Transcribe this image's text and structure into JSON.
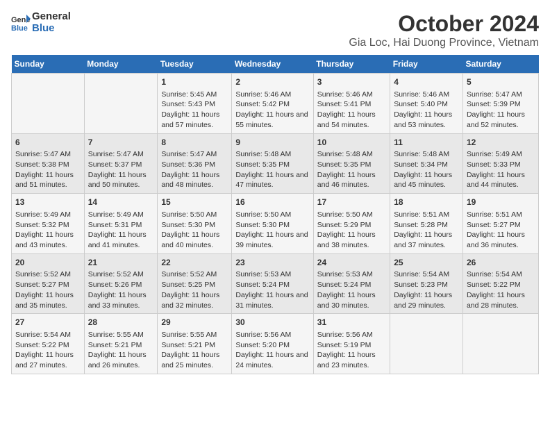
{
  "logo": {
    "line1": "General",
    "line2": "Blue"
  },
  "title": "October 2024",
  "subtitle": "Gia Loc, Hai Duong Province, Vietnam",
  "weekdays": [
    "Sunday",
    "Monday",
    "Tuesday",
    "Wednesday",
    "Thursday",
    "Friday",
    "Saturday"
  ],
  "weeks": [
    [
      {
        "day": "",
        "content": ""
      },
      {
        "day": "",
        "content": ""
      },
      {
        "day": "1",
        "content": "Sunrise: 5:45 AM\nSunset: 5:43 PM\nDaylight: 11 hours and 57 minutes."
      },
      {
        "day": "2",
        "content": "Sunrise: 5:46 AM\nSunset: 5:42 PM\nDaylight: 11 hours and 55 minutes."
      },
      {
        "day": "3",
        "content": "Sunrise: 5:46 AM\nSunset: 5:41 PM\nDaylight: 11 hours and 54 minutes."
      },
      {
        "day": "4",
        "content": "Sunrise: 5:46 AM\nSunset: 5:40 PM\nDaylight: 11 hours and 53 minutes."
      },
      {
        "day": "5",
        "content": "Sunrise: 5:47 AM\nSunset: 5:39 PM\nDaylight: 11 hours and 52 minutes."
      }
    ],
    [
      {
        "day": "6",
        "content": "Sunrise: 5:47 AM\nSunset: 5:38 PM\nDaylight: 11 hours and 51 minutes."
      },
      {
        "day": "7",
        "content": "Sunrise: 5:47 AM\nSunset: 5:37 PM\nDaylight: 11 hours and 50 minutes."
      },
      {
        "day": "8",
        "content": "Sunrise: 5:47 AM\nSunset: 5:36 PM\nDaylight: 11 hours and 48 minutes."
      },
      {
        "day": "9",
        "content": "Sunrise: 5:48 AM\nSunset: 5:35 PM\nDaylight: 11 hours and 47 minutes."
      },
      {
        "day": "10",
        "content": "Sunrise: 5:48 AM\nSunset: 5:35 PM\nDaylight: 11 hours and 46 minutes."
      },
      {
        "day": "11",
        "content": "Sunrise: 5:48 AM\nSunset: 5:34 PM\nDaylight: 11 hours and 45 minutes."
      },
      {
        "day": "12",
        "content": "Sunrise: 5:49 AM\nSunset: 5:33 PM\nDaylight: 11 hours and 44 minutes."
      }
    ],
    [
      {
        "day": "13",
        "content": "Sunrise: 5:49 AM\nSunset: 5:32 PM\nDaylight: 11 hours and 43 minutes."
      },
      {
        "day": "14",
        "content": "Sunrise: 5:49 AM\nSunset: 5:31 PM\nDaylight: 11 hours and 41 minutes."
      },
      {
        "day": "15",
        "content": "Sunrise: 5:50 AM\nSunset: 5:30 PM\nDaylight: 11 hours and 40 minutes."
      },
      {
        "day": "16",
        "content": "Sunrise: 5:50 AM\nSunset: 5:30 PM\nDaylight: 11 hours and 39 minutes."
      },
      {
        "day": "17",
        "content": "Sunrise: 5:50 AM\nSunset: 5:29 PM\nDaylight: 11 hours and 38 minutes."
      },
      {
        "day": "18",
        "content": "Sunrise: 5:51 AM\nSunset: 5:28 PM\nDaylight: 11 hours and 37 minutes."
      },
      {
        "day": "19",
        "content": "Sunrise: 5:51 AM\nSunset: 5:27 PM\nDaylight: 11 hours and 36 minutes."
      }
    ],
    [
      {
        "day": "20",
        "content": "Sunrise: 5:52 AM\nSunset: 5:27 PM\nDaylight: 11 hours and 35 minutes."
      },
      {
        "day": "21",
        "content": "Sunrise: 5:52 AM\nSunset: 5:26 PM\nDaylight: 11 hours and 33 minutes."
      },
      {
        "day": "22",
        "content": "Sunrise: 5:52 AM\nSunset: 5:25 PM\nDaylight: 11 hours and 32 minutes."
      },
      {
        "day": "23",
        "content": "Sunrise: 5:53 AM\nSunset: 5:24 PM\nDaylight: 11 hours and 31 minutes."
      },
      {
        "day": "24",
        "content": "Sunrise: 5:53 AM\nSunset: 5:24 PM\nDaylight: 11 hours and 30 minutes."
      },
      {
        "day": "25",
        "content": "Sunrise: 5:54 AM\nSunset: 5:23 PM\nDaylight: 11 hours and 29 minutes."
      },
      {
        "day": "26",
        "content": "Sunrise: 5:54 AM\nSunset: 5:22 PM\nDaylight: 11 hours and 28 minutes."
      }
    ],
    [
      {
        "day": "27",
        "content": "Sunrise: 5:54 AM\nSunset: 5:22 PM\nDaylight: 11 hours and 27 minutes."
      },
      {
        "day": "28",
        "content": "Sunrise: 5:55 AM\nSunset: 5:21 PM\nDaylight: 11 hours and 26 minutes."
      },
      {
        "day": "29",
        "content": "Sunrise: 5:55 AM\nSunset: 5:21 PM\nDaylight: 11 hours and 25 minutes."
      },
      {
        "day": "30",
        "content": "Sunrise: 5:56 AM\nSunset: 5:20 PM\nDaylight: 11 hours and 24 minutes."
      },
      {
        "day": "31",
        "content": "Sunrise: 5:56 AM\nSunset: 5:19 PM\nDaylight: 11 hours and 23 minutes."
      },
      {
        "day": "",
        "content": ""
      },
      {
        "day": "",
        "content": ""
      }
    ]
  ]
}
